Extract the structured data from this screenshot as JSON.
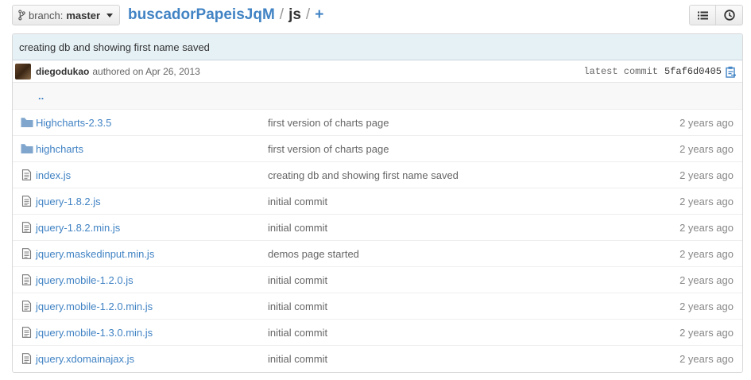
{
  "branch": {
    "label": "branch:",
    "name": "master"
  },
  "breadcrumb": {
    "repo": "buscadorPapeisJqM",
    "sep1": "/",
    "current": "js",
    "sep2": "/",
    "plus": "+"
  },
  "toolbar": {
    "list_icon": "list-icon",
    "history_icon": "history-icon"
  },
  "commit": {
    "message": "creating db and showing first name saved",
    "author": "diegodukao",
    "authored": "authored on Apr 26, 2013",
    "latest_label": "latest commit",
    "sha": "5faf6d0405"
  },
  "uplink": "..",
  "files": [
    {
      "type": "dir",
      "name": "Highcharts-2.3.5",
      "message": "first version of charts page",
      "age": "2 years ago"
    },
    {
      "type": "dir",
      "name": "highcharts",
      "message": "first version of charts page",
      "age": "2 years ago"
    },
    {
      "type": "file",
      "name": "index.js",
      "message": "creating db and showing first name saved",
      "age": "2 years ago"
    },
    {
      "type": "file",
      "name": "jquery-1.8.2.js",
      "message": "initial commit",
      "age": "2 years ago"
    },
    {
      "type": "file",
      "name": "jquery-1.8.2.min.js",
      "message": "initial commit",
      "age": "2 years ago"
    },
    {
      "type": "file",
      "name": "jquery.maskedinput.min.js",
      "message": "demos page started",
      "age": "2 years ago"
    },
    {
      "type": "file",
      "name": "jquery.mobile-1.2.0.js",
      "message": "initial commit",
      "age": "2 years ago"
    },
    {
      "type": "file",
      "name": "jquery.mobile-1.2.0.min.js",
      "message": "initial commit",
      "age": "2 years ago"
    },
    {
      "type": "file",
      "name": "jquery.mobile-1.3.0.min.js",
      "message": "initial commit",
      "age": "2 years ago"
    },
    {
      "type": "file",
      "name": "jquery.xdomainajax.js",
      "message": "initial commit",
      "age": "2 years ago"
    }
  ],
  "colors": {
    "link": "#4183c4",
    "commit_bg": "#e6f1f6",
    "folder": "#80a6cd"
  }
}
